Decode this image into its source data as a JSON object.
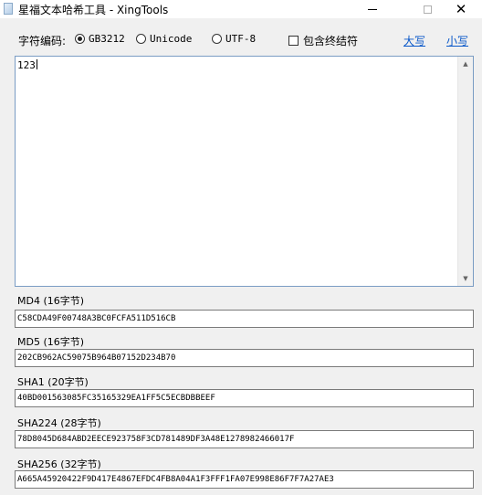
{
  "window": {
    "title": "星福文本哈希工具 - XingTools",
    "close_glyph": "✕"
  },
  "toolbar": {
    "encoding_label": "字符编码:",
    "options": [
      {
        "label": "GB3212",
        "checked": true
      },
      {
        "label": "Unicode",
        "checked": false
      },
      {
        "label": "UTF-8",
        "checked": false
      }
    ],
    "include_terminator_label": "包含终结符",
    "include_terminator_checked": false,
    "uppercase_label": "大写",
    "lowercase_label": "小写",
    "link_color": "#0a58c9"
  },
  "input": {
    "text": "123",
    "scroll_up_glyph": "▲",
    "scroll_down_glyph": "▼"
  },
  "hashes": [
    {
      "label": "MD4 (16字节)",
      "value": "C58CDA49F00748A3BC0FCFA511D516CB"
    },
    {
      "label": "MD5 (16字节)",
      "value": "202CB962AC59075B964B07152D234B70"
    },
    {
      "label": "SHA1 (20字节)",
      "value": "40BD001563085FC35165329EA1FF5C5ECBDBBEEF"
    },
    {
      "label": "SHA224 (28字节)",
      "value": "78D8045D684ABD2EECE923758F3CD781489DF3A48E1278982466017F"
    },
    {
      "label": "SHA256 (32字节)",
      "value": "A665A45920422F9D417E4867EFDC4FB8A04A1F3FFF1FA07E998E86F7F7A27AE3"
    }
  ]
}
